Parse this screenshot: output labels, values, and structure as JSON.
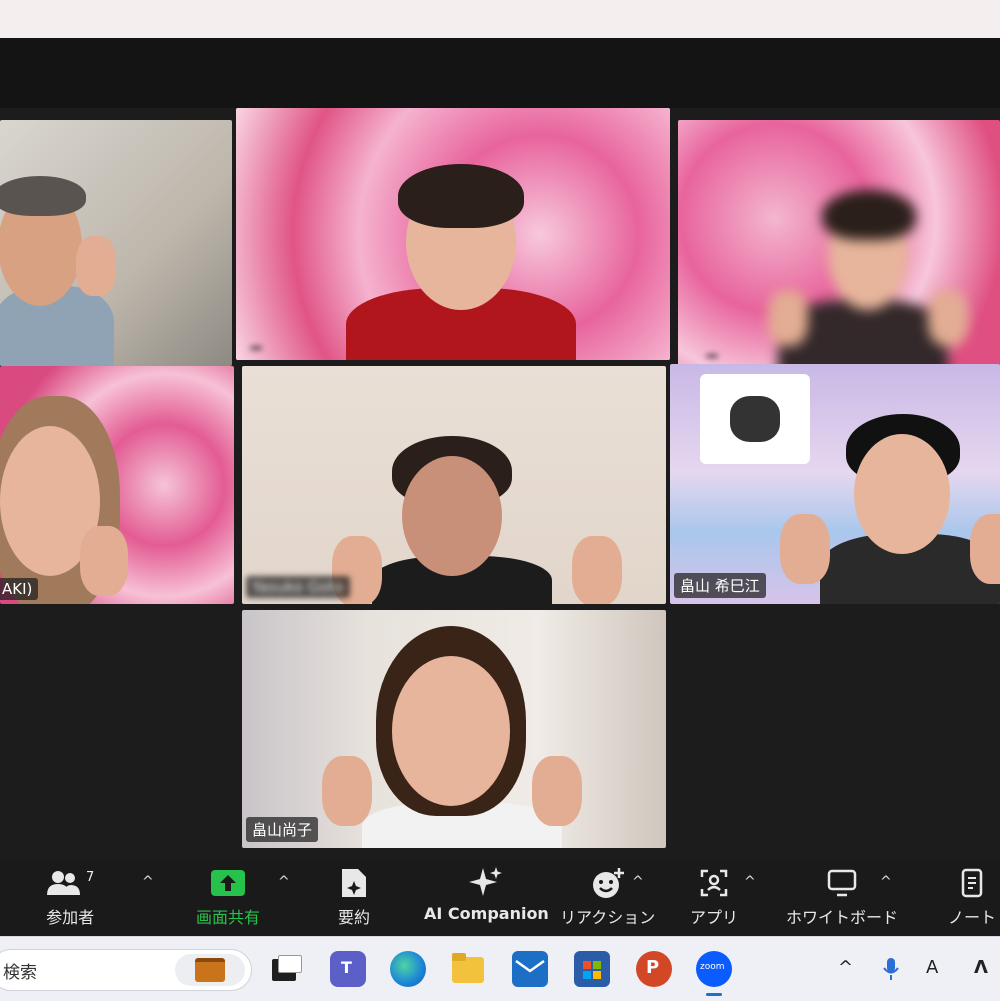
{
  "participants": [
    {
      "name": "",
      "tile": "top-left"
    },
    {
      "name": "",
      "tile": "top-center"
    },
    {
      "name": "",
      "tile": "top-right"
    },
    {
      "name": "AKI)",
      "tile": "middle-left"
    },
    {
      "name": "Yasuko Goto",
      "tile": "middle-center"
    },
    {
      "name": "畠山 希巳江",
      "tile": "middle-right"
    },
    {
      "name": "畠山尚子",
      "tile": "bottom-center"
    }
  ],
  "toolbar": {
    "participants_label": "参加者",
    "participants_count": "7",
    "share_label": "画面共有",
    "summary_label": "要約",
    "ai_label": "AI Companion",
    "reaction_label": "リアクション",
    "apps_label": "アプリ",
    "whiteboard_label": "ホワイトボード",
    "notes_label": "ノート",
    "share_color": "#27c24c"
  },
  "taskbar": {
    "search_placeholder": "検索",
    "apps": [
      "file-explorer-icon",
      "teams-icon",
      "edge-icon",
      "folder-icon",
      "mail-icon",
      "store-icon",
      "powerpoint-icon",
      "zoom-icon"
    ],
    "zoom_label": "zoom"
  }
}
